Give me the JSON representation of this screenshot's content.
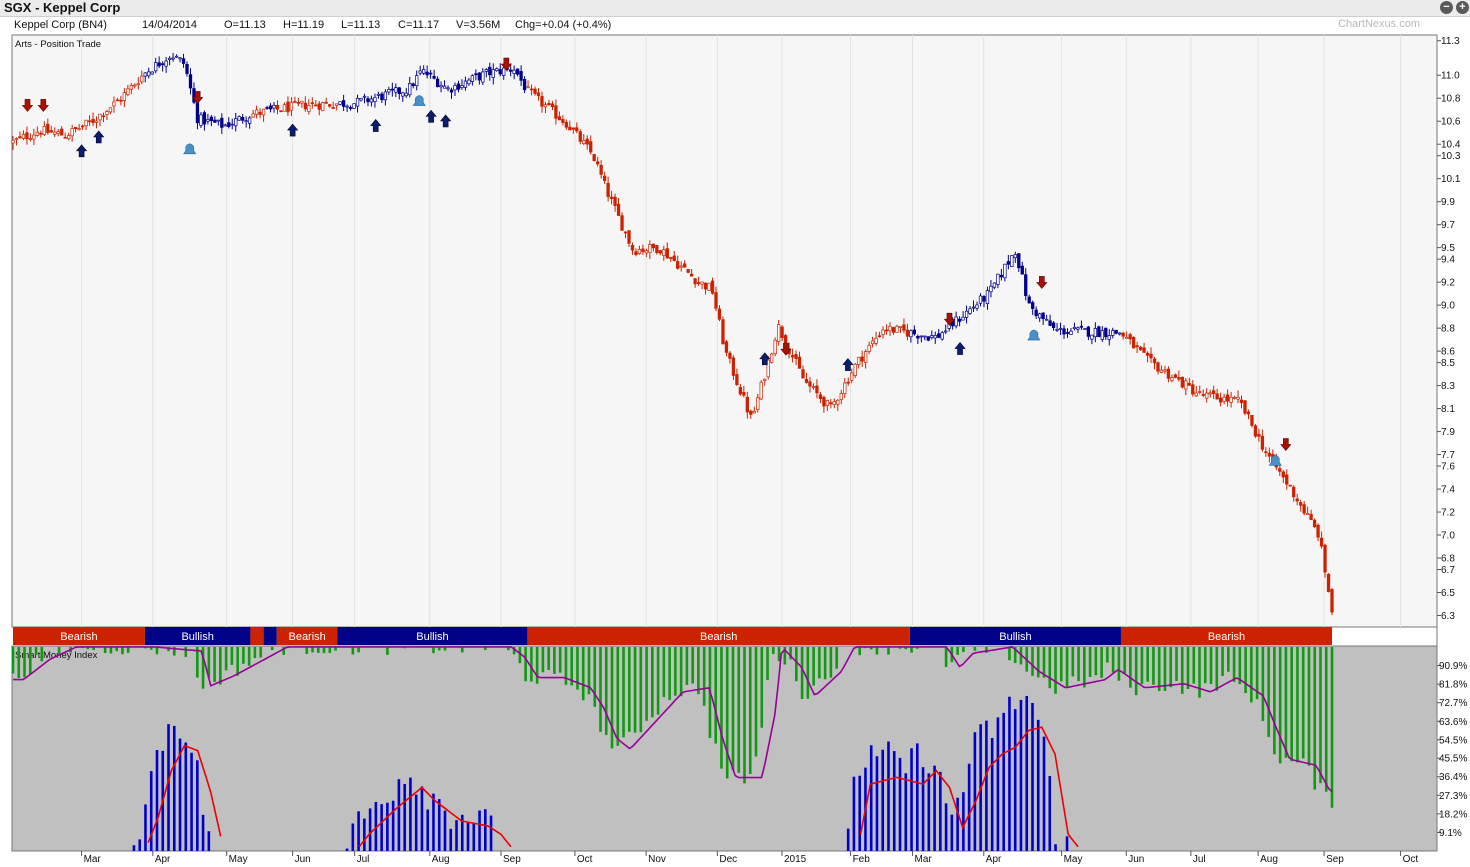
{
  "app": {
    "title": "SGX - Keppel Corp",
    "zoom_out_icon": "minus-circle-icon",
    "zoom_in_icon": "plus-circle-icon"
  },
  "quote": {
    "name": "Keppel Corp (BN4)",
    "date": "14/04/2014",
    "open": "O=11.13",
    "high": "H=11.19",
    "low": "L=11.13",
    "close": "C=11.17",
    "volume": "V=3.56M",
    "change": "Chg=+0.04 (+0.4%)"
  },
  "watermark": "ChartNexus.com",
  "colors": {
    "bear": "#cc2200",
    "bull": "#000088",
    "smi_bar": "#119911",
    "vol_bar": "#0000cc",
    "smi_line": "#990099",
    "vol_line": "#ee0000",
    "signal_sell": "#aa1100",
    "signal_buy": "#0a1e6e",
    "signal_alert": "#4a90c8"
  },
  "chart_data": [
    {
      "type": "candlestick",
      "legend": "Arts - Position Trade",
      "ylim": [
        6.2,
        11.35
      ],
      "yticks": [
        11.3,
        11.0,
        10.8,
        10.6,
        10.4,
        10.3,
        10.1,
        9.9,
        9.7,
        9.5,
        9.4,
        9.2,
        9.0,
        8.8,
        8.6,
        8.5,
        8.3,
        8.1,
        7.9,
        7.7,
        7.6,
        7.4,
        7.2,
        7.0,
        6.8,
        6.7,
        6.5,
        6.3
      ],
      "ytick_labels": [
        "11.3",
        "11.0",
        "10.8",
        "10.6",
        "10.4",
        "10.3",
        "10.1",
        "9.9",
        "9.7",
        "9.5",
        "9.4",
        "9.2",
        "9.0",
        "8.8",
        "8.6",
        "8.5",
        "8.3",
        "8.1",
        "7.9",
        "7.7",
        "7.6",
        "7.4",
        "7.2",
        "7.0",
        "6.8",
        "6.7",
        "6.5",
        "6.3"
      ],
      "xticks": [
        "Mar",
        "Apr",
        "May",
        "Jun",
        "Jul",
        "Aug",
        "Sep",
        "Oct",
        "Nov",
        "Dec",
        "2015",
        "Feb",
        "Mar",
        "Apr",
        "May",
        "Jun",
        "Jul",
        "Aug",
        "Sep",
        "Oct"
      ],
      "xtick_pos": [
        0.052,
        0.106,
        0.162,
        0.212,
        0.259,
        0.316,
        0.37,
        0.426,
        0.48,
        0.534,
        0.583,
        0.635,
        0.682,
        0.736,
        0.795,
        0.844,
        0.893,
        0.944,
        0.994,
        1.052
      ],
      "close_series": [
        [
          0.0,
          10.42
        ],
        [
          0.02,
          10.52
        ],
        [
          0.04,
          10.48
        ],
        [
          0.06,
          10.6
        ],
        [
          0.08,
          10.78
        ],
        [
          0.1,
          11.02
        ],
        [
          0.12,
          11.18
        ],
        [
          0.13,
          11.1
        ],
        [
          0.14,
          10.62
        ],
        [
          0.16,
          10.56
        ],
        [
          0.18,
          10.66
        ],
        [
          0.22,
          10.74
        ],
        [
          0.26,
          10.76
        ],
        [
          0.3,
          10.88
        ],
        [
          0.31,
          11.04
        ],
        [
          0.33,
          10.88
        ],
        [
          0.36,
          11.02
        ],
        [
          0.38,
          11.06
        ],
        [
          0.39,
          10.86
        ],
        [
          0.42,
          10.58
        ],
        [
          0.44,
          10.3
        ],
        [
          0.45,
          10.0
        ],
        [
          0.47,
          9.48
        ],
        [
          0.49,
          9.5
        ],
        [
          0.52,
          9.2
        ],
        [
          0.53,
          9.14
        ],
        [
          0.54,
          8.6
        ],
        [
          0.56,
          8.0
        ],
        [
          0.57,
          8.4
        ],
        [
          0.58,
          8.82
        ],
        [
          0.6,
          8.34
        ],
        [
          0.62,
          8.1
        ],
        [
          0.64,
          8.5
        ],
        [
          0.66,
          8.8
        ],
        [
          0.7,
          8.72
        ],
        [
          0.74,
          9.1
        ],
        [
          0.76,
          9.48
        ],
        [
          0.77,
          9.0
        ],
        [
          0.79,
          8.78
        ],
        [
          0.84,
          8.76
        ],
        [
          0.86,
          8.52
        ],
        [
          0.9,
          8.22
        ],
        [
          0.93,
          8.16
        ],
        [
          0.95,
          7.72
        ],
        [
          0.97,
          7.38
        ],
        [
          0.99,
          7.0
        ],
        [
          1.0,
          6.34
        ]
      ],
      "regime_bands": [
        {
          "label": "Bearish",
          "start": 0.0,
          "end": 0.1
        },
        {
          "label": "Bullish",
          "start": 0.1,
          "end": 0.18
        },
        {
          "label": "",
          "start": 0.18,
          "end": 0.19
        },
        {
          "label": "",
          "start": 0.19,
          "end": 0.2
        },
        {
          "label": "Bearish",
          "start": 0.2,
          "end": 0.246
        },
        {
          "label": "Bullish",
          "start": 0.246,
          "end": 0.39
        },
        {
          "label": "Bearish",
          "start": 0.39,
          "end": 0.68
        },
        {
          "label": "Bullish",
          "start": 0.68,
          "end": 0.84
        },
        {
          "label": "Bearish",
          "start": 0.84,
          "end": 1.0
        }
      ],
      "signals": [
        {
          "type": "sell",
          "x": 0.011,
          "y": 10.72
        },
        {
          "type": "sell",
          "x": 0.023,
          "y": 10.72
        },
        {
          "type": "buy",
          "x": 0.052,
          "y": 10.36
        },
        {
          "type": "buy",
          "x": 0.065,
          "y": 10.48
        },
        {
          "type": "alert",
          "x": 0.134,
          "y": 10.36
        },
        {
          "type": "sell",
          "x": 0.14,
          "y": 10.79
        },
        {
          "type": "buy",
          "x": 0.212,
          "y": 10.54
        },
        {
          "type": "buy",
          "x": 0.275,
          "y": 10.58
        },
        {
          "type": "alert",
          "x": 0.308,
          "y": 10.78
        },
        {
          "type": "buy",
          "x": 0.317,
          "y": 10.66
        },
        {
          "type": "buy",
          "x": 0.328,
          "y": 10.62
        },
        {
          "type": "sell",
          "x": 0.374,
          "y": 11.08
        },
        {
          "type": "buy",
          "x": 0.57,
          "y": 8.55
        },
        {
          "type": "sell",
          "x": 0.586,
          "y": 8.6
        },
        {
          "type": "buy",
          "x": 0.633,
          "y": 8.5
        },
        {
          "type": "sell",
          "x": 0.71,
          "y": 8.86
        },
        {
          "type": "buy",
          "x": 0.718,
          "y": 8.64
        },
        {
          "type": "alert",
          "x": 0.774,
          "y": 8.74
        },
        {
          "type": "sell",
          "x": 0.78,
          "y": 9.18
        },
        {
          "type": "alert",
          "x": 0.957,
          "y": 7.65
        },
        {
          "type": "sell",
          "x": 0.965,
          "y": 7.77
        }
      ]
    },
    {
      "type": "bar",
      "legend": "Smart Money Index",
      "ylim": [
        0,
        100
      ],
      "yticks": [
        90.9,
        81.8,
        72.7,
        63.6,
        54.5,
        45.5,
        36.4,
        27.3,
        18.2,
        9.1
      ],
      "ytick_labels": [
        "90.9%",
        "81.8%",
        "72.7%",
        "63.6%",
        "54.5%",
        "45.5%",
        "36.4%",
        "27.3%",
        "18.2%",
        "9.1%"
      ],
      "series": [
        {
          "values": [
            [
              0.0,
              84
            ],
            [
              0.02,
              94
            ],
            [
              0.04,
              100
            ],
            [
              0.06,
              100
            ],
            [
              0.1,
              100
            ],
            [
              0.135,
              98
            ],
            [
              0.142,
              81
            ],
            [
              0.16,
              86
            ],
            [
              0.2,
              100
            ],
            [
              0.3,
              100
            ],
            [
              0.37,
              100
            ],
            [
              0.38,
              95
            ],
            [
              0.39,
              85
            ],
            [
              0.41,
              85
            ],
            [
              0.43,
              80
            ],
            [
              0.44,
              70
            ],
            [
              0.45,
              55
            ],
            [
              0.46,
              50
            ],
            [
              0.48,
              64
            ],
            [
              0.5,
              78
            ],
            [
              0.52,
              80
            ],
            [
              0.53,
              55
            ],
            [
              0.54,
              36
            ],
            [
              0.56,
              36
            ],
            [
              0.57,
              68
            ],
            [
              0.575,
              100
            ],
            [
              0.59,
              90
            ],
            [
              0.6,
              76
            ],
            [
              0.62,
              88
            ],
            [
              0.63,
              100
            ],
            [
              0.7,
              100
            ],
            [
              0.71,
              90
            ],
            [
              0.72,
              97
            ],
            [
              0.75,
              100
            ],
            [
              0.77,
              88
            ],
            [
              0.79,
              80
            ],
            [
              0.82,
              84
            ],
            [
              0.83,
              89
            ],
            [
              0.85,
              80
            ],
            [
              0.88,
              82
            ],
            [
              0.9,
              78
            ],
            [
              0.92,
              85
            ],
            [
              0.94,
              76
            ],
            [
              0.95,
              60
            ],
            [
              0.96,
              45
            ],
            [
              0.98,
              42
            ],
            [
              0.99,
              30
            ],
            [
              1.0,
              25
            ]
          ]
        },
        {
          "values": [
            [
              0.0,
              0
            ],
            [
              0.06,
              0
            ],
            [
              0.09,
              0
            ],
            [
              0.1,
              20
            ],
            [
              0.11,
              48
            ],
            [
              0.12,
              63
            ],
            [
              0.13,
              60
            ],
            [
              0.14,
              35
            ],
            [
              0.15,
              0
            ],
            [
              0.25,
              0
            ],
            [
              0.26,
              10
            ],
            [
              0.28,
              25
            ],
            [
              0.3,
              38
            ],
            [
              0.31,
              30
            ],
            [
              0.33,
              18
            ],
            [
              0.35,
              15
            ],
            [
              0.36,
              10
            ],
            [
              0.37,
              0
            ],
            [
              0.63,
              0
            ],
            [
              0.64,
              40
            ],
            [
              0.66,
              44
            ],
            [
              0.68,
              40
            ],
            [
              0.69,
              48
            ],
            [
              0.7,
              38
            ],
            [
              0.71,
              14
            ],
            [
              0.72,
              30
            ],
            [
              0.73,
              50
            ],
            [
              0.74,
              58
            ],
            [
              0.75,
              62
            ],
            [
              0.76,
              72
            ],
            [
              0.77,
              74
            ],
            [
              0.78,
              58
            ],
            [
              0.79,
              10
            ],
            [
              0.8,
              0
            ],
            [
              1.0,
              0
            ]
          ]
        }
      ]
    }
  ]
}
